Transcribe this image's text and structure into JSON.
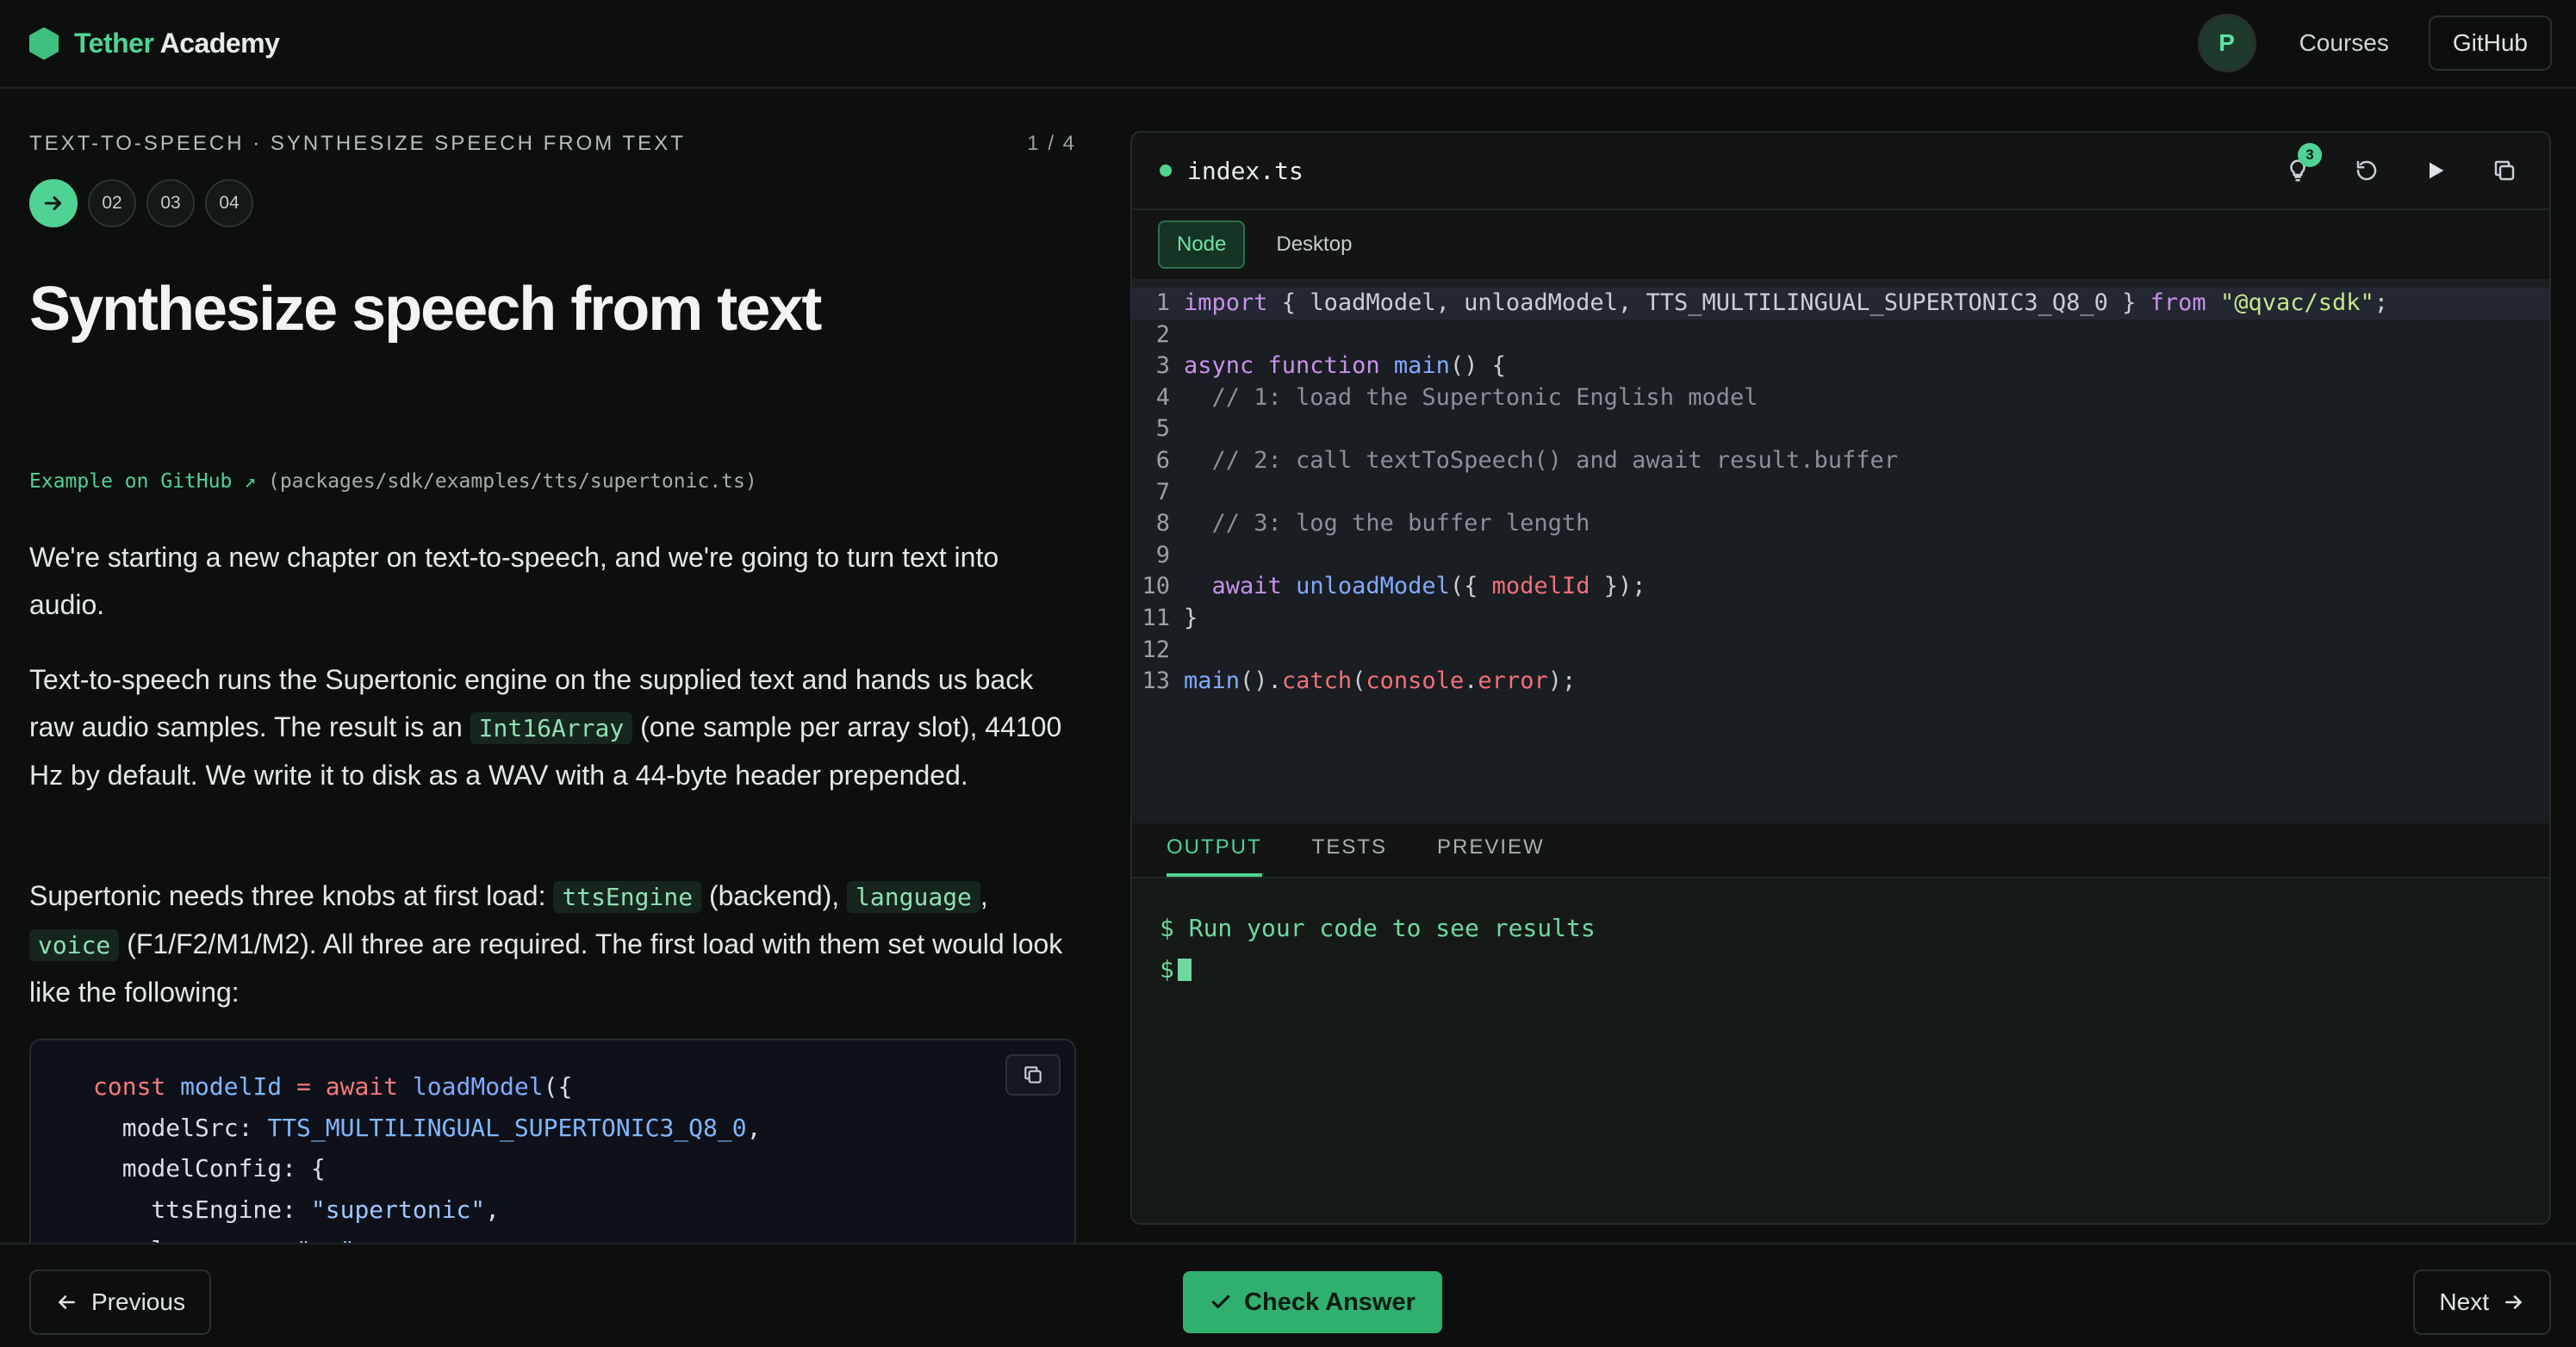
{
  "header": {
    "brand_part1": "Tether",
    "brand_part2": "Academy",
    "avatar_initial": "P",
    "nav_courses": "Courses",
    "nav_github": "GitHub"
  },
  "lesson": {
    "breadcrumb": "TEXT-TO-SPEECH · SYNTHESIZE SPEECH FROM TEXT",
    "counter": "1 / 4",
    "steps": [
      "02",
      "03",
      "04"
    ],
    "title": "Synthesize speech from text",
    "example_link": "Example on GitHub ↗",
    "example_path": "(packages/sdk/examples/tts/supertonic.ts)",
    "p1": "We're starting a new chapter on text-to-speech, and we're going to turn text into audio.",
    "p2_a": "Text-to-speech runs the Supertonic engine on the supplied text and hands us back raw audio samples. The result is an ",
    "p2_code": "Int16Array",
    "p2_b": " (one sample per array slot), 44100 Hz by default. We write it to disk as a WAV with a 44-byte header prepended.",
    "p3_a": "Supertonic needs three knobs at first load: ",
    "p3_code1": "ttsEngine",
    "p3_b": " (backend), ",
    "p3_code2": "language",
    "p3_c": ", ",
    "p3_code3": "voice",
    "p3_d": " (F1/F2/M1/M2). All three are required. The first load with them set would look like the following:"
  },
  "editor": {
    "filename": "index.ts",
    "hint_count": "3",
    "env_tabs": [
      "Node",
      "Desktop"
    ],
    "line_numbers": [
      "1",
      "2",
      "3",
      "4",
      "5",
      "6",
      "7",
      "8",
      "9",
      "10",
      "11",
      "12",
      "13"
    ],
    "output_tabs": [
      "OUTPUT",
      "TESTS",
      "PREVIEW"
    ],
    "terminal_line1": "$ Run your code to see results",
    "terminal_prompt": "$"
  },
  "footer": {
    "previous": "Previous",
    "check": "Check Answer",
    "next": "Next"
  },
  "colors": {
    "accent": "#4fd394",
    "background": "#0d0f0e",
    "editor_bg": "#1a1d22"
  }
}
